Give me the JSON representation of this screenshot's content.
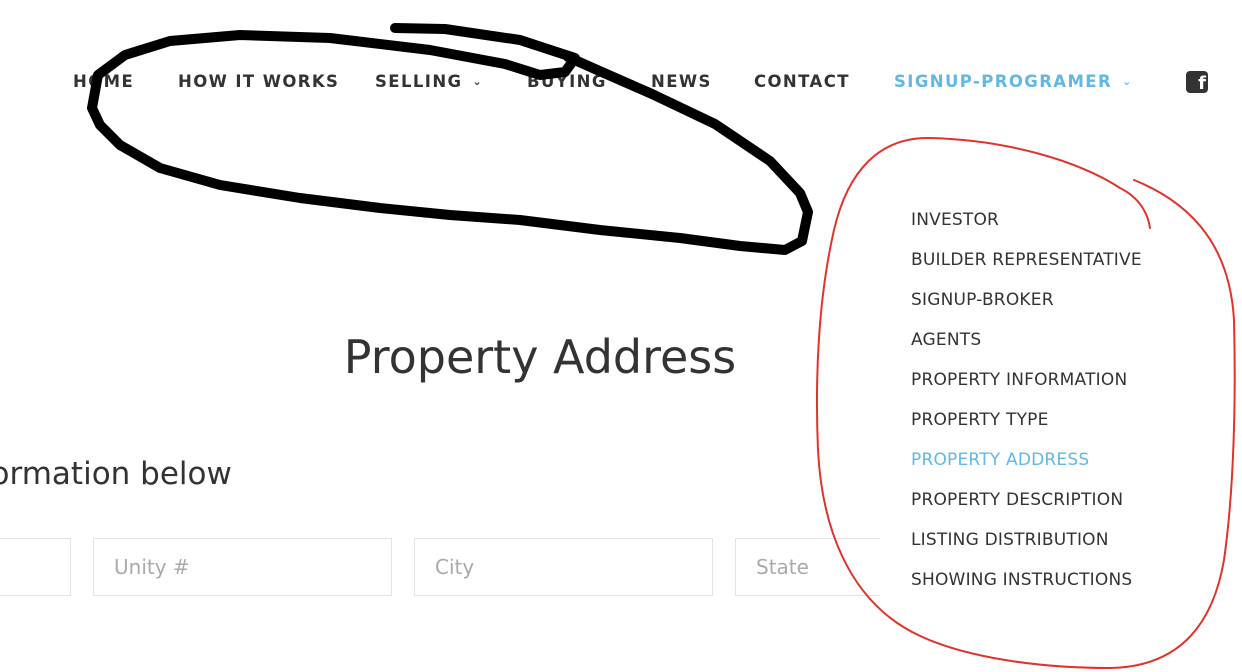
{
  "nav": {
    "items": [
      {
        "label": "HOME"
      },
      {
        "label": "HOW IT WORKS"
      },
      {
        "label": "SELLING",
        "chevron": "⌄"
      },
      {
        "label": "BUYING"
      },
      {
        "label": "NEWS"
      },
      {
        "label": "CONTACT"
      },
      {
        "label": "SIGNUP-PROGRAMER",
        "chevron": "⌄",
        "active": true
      }
    ],
    "social_icon": "facebook-icon",
    "social_glyph": "f"
  },
  "dropdown": {
    "items": [
      {
        "label": "INVESTOR"
      },
      {
        "label": "BUILDER REPRESENTATIVE"
      },
      {
        "label": "SIGNUP-BROKER"
      },
      {
        "label": "AGENTS"
      },
      {
        "label": "PROPERTY INFORMATION"
      },
      {
        "label": "PROPERTY TYPE"
      },
      {
        "label": "PROPERTY ADDRESS",
        "active": true
      },
      {
        "label": "PROPERTY DESCRIPTION"
      },
      {
        "label": "LISTING DISTRIBUTION"
      },
      {
        "label": "SHOWING INSTRUCTIONS"
      }
    ]
  },
  "main": {
    "title": "Property Address",
    "subtitle": "nformation below",
    "fields": [
      {
        "placeholder": ""
      },
      {
        "placeholder": "Unity #"
      },
      {
        "placeholder": "City"
      },
      {
        "placeholder": "State"
      }
    ]
  },
  "colors": {
    "accent": "#62b8e3",
    "text": "#333333",
    "annotation_black": "#000000",
    "annotation_red": "#e0342a"
  }
}
